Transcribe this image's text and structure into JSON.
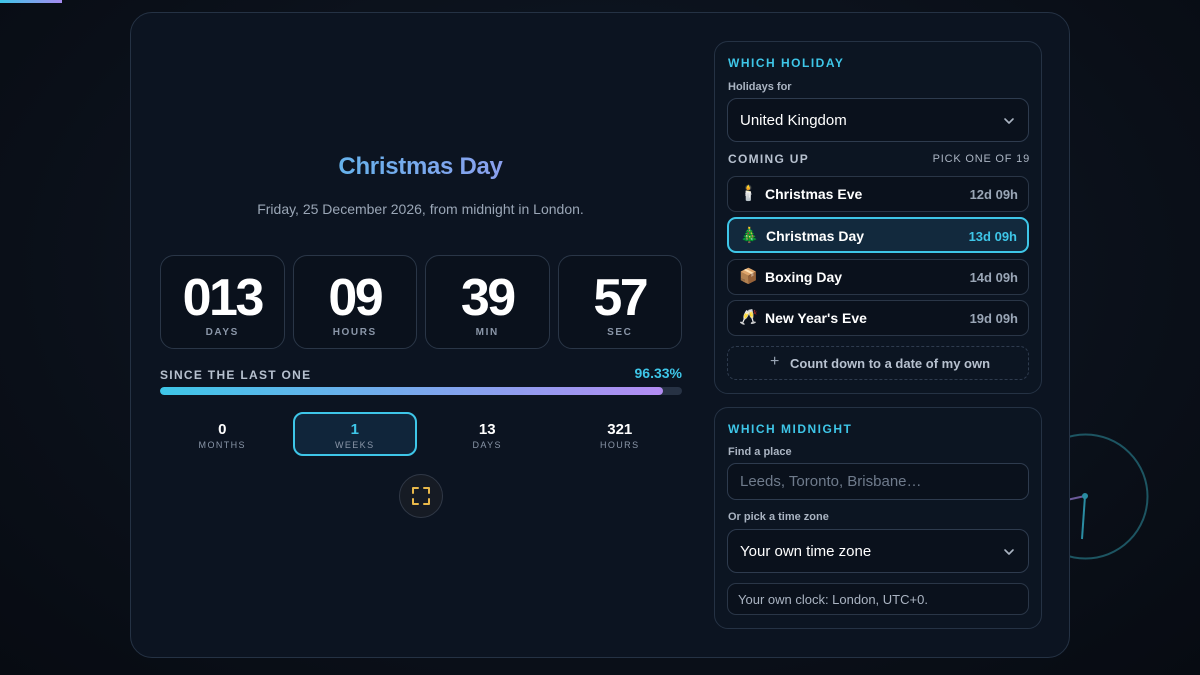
{
  "holiday": {
    "title": "Christmas Day",
    "subtitle": "Friday, 25 December 2026, from midnight in London."
  },
  "countdown": [
    {
      "value": "013",
      "unit": "DAYS"
    },
    {
      "value": "09",
      "unit": "HOURS"
    },
    {
      "value": "39",
      "unit": "MIN"
    },
    {
      "value": "57",
      "unit": "SEC"
    }
  ],
  "since": {
    "label": "SINCE THE LAST ONE",
    "percent_text": "96.33%",
    "percent": 96.33
  },
  "elapsed": [
    {
      "value": "0",
      "unit": "MONTHS",
      "active": false
    },
    {
      "value": "1",
      "unit": "WEEKS",
      "active": true
    },
    {
      "value": "13",
      "unit": "DAYS",
      "active": false
    },
    {
      "value": "321",
      "unit": "HOURS",
      "active": false
    }
  ],
  "icons": {
    "fullscreen": "fullscreen-icon",
    "chevron": "chevron-down-icon",
    "plus": "plus-icon"
  },
  "which_holiday": {
    "heading": "WHICH HOLIDAY",
    "country_label": "Holidays for",
    "country_value": "United Kingdom",
    "coming_up": "COMING UP",
    "pick_count": "PICK ONE OF 19",
    "holidays": [
      {
        "emoji": "🕯️",
        "icon_name": "candle-icon",
        "name": "Christmas Eve",
        "time": "12d 09h",
        "active": false
      },
      {
        "emoji": "🎄",
        "icon_name": "christmas-tree-icon",
        "name": "Christmas Day",
        "time": "13d 09h",
        "active": true
      },
      {
        "emoji": "📦",
        "icon_name": "package-icon",
        "name": "Boxing Day",
        "time": "14d 09h",
        "active": false
      },
      {
        "emoji": "🥂",
        "icon_name": "champagne-glasses-icon",
        "name": "New Year's Eve",
        "time": "19d 09h",
        "active": false
      }
    ],
    "custom_label": "Count down to a date of my own"
  },
  "which_midnight": {
    "heading": "WHICH MIDNIGHT",
    "place_label": "Find a place",
    "place_placeholder": "Leeds, Toronto, Brisbane…",
    "zone_label": "Or pick a time zone",
    "zone_value": "Your own time zone",
    "clock_note": "Your own clock: London, UTC+0."
  },
  "colors": {
    "accent": "#3ec6e8",
    "accent2": "#b38cf2",
    "background": "#0c1421"
  }
}
